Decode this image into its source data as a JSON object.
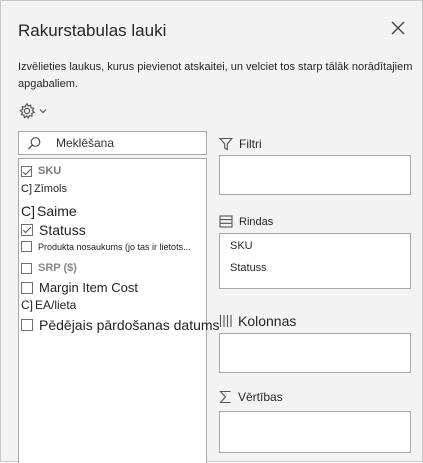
{
  "panel": {
    "title": "Rakurstabulas lauki",
    "description": "Izvēlieties laukus, kurus pievienot atskaitei, un velciet tos starp tālāk norādītajiem apgabaliem."
  },
  "search": {
    "placeholder": "Meklēšana"
  },
  "fields": [
    {
      "label": "SKU",
      "checked": true
    },
    {
      "prefix": "C]",
      "label": "Zīmols",
      "checked": false
    },
    {
      "prefix": "C]",
      "label": "Saime",
      "checked": false
    },
    {
      "label": "Statuss",
      "checked": true
    },
    {
      "label": "Produkta nosaukums (jo tas ir lietots...",
      "checked": false
    },
    {
      "label": "SRP ($)",
      "checked": false
    },
    {
      "label": "Margin Item Cost",
      "checked": false
    },
    {
      "prefix": "C]",
      "label": "EA/lieta",
      "checked": false
    },
    {
      "label": "Pēdējais pārdošanas datums",
      "checked": false
    }
  ],
  "areas": {
    "filters": {
      "label": "Filtri",
      "items": []
    },
    "rows": {
      "label": "Rindas",
      "items": [
        "SKU",
        "Statuss"
      ]
    },
    "columns": {
      "label": "Kolonnas",
      "items": []
    },
    "values": {
      "label": "Vērtības",
      "items": []
    }
  },
  "icons": {
    "close": "close-icon",
    "settings": "gear-icon",
    "search": "search-icon",
    "filter": "filter-icon",
    "rows": "rows-icon",
    "columns": "columns-icon",
    "values": "sigma-icon"
  }
}
